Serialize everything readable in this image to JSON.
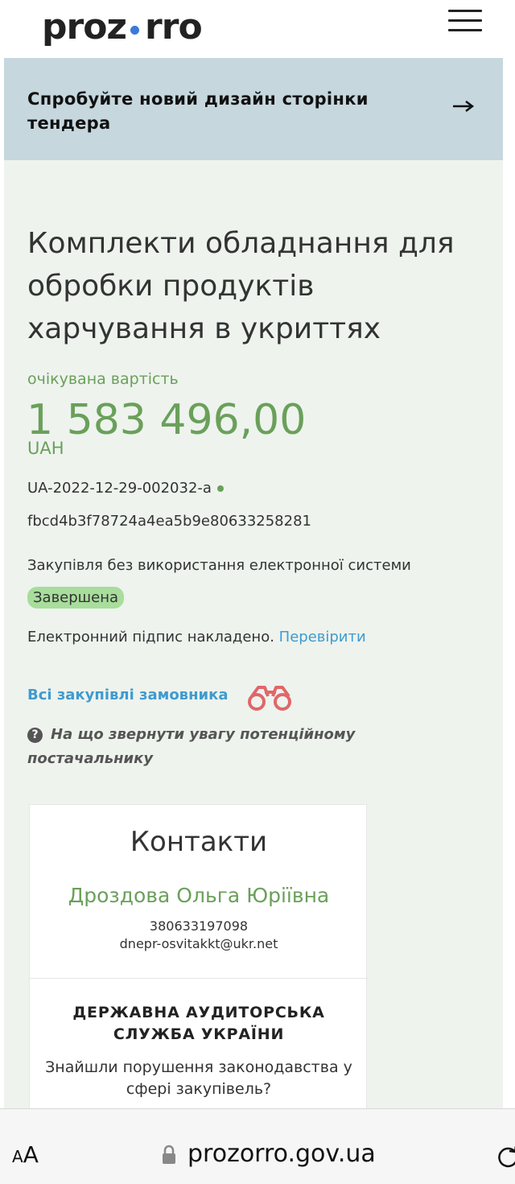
{
  "header": {
    "logo_left": "proz",
    "logo_right": "rro",
    "menu_icon": "hamburger-menu-icon"
  },
  "banner": {
    "text": "Спробуйте новий дизайн сторінки тендера",
    "icon": "arrow-right-icon"
  },
  "tender": {
    "title": "Комплекти обладнання для обробки продуктів харчування в укриттях",
    "estimated_label": "очікувана вартість",
    "amount": "1 583 496,00",
    "currency": "UAH",
    "id": "UA-2022-12-29-002032-a",
    "hash": "fbcd4b3f78724a4ea5b9e80633258281",
    "procurement_type": "Закупівля без використання електронної системи",
    "status": "Завершена",
    "signature_text": "Електронний підпис накладено. ",
    "signature_link": "Перевірити",
    "all_purchases_link": "Всі закупівлі замовника",
    "attention_text": "На що звернути увагу потенційному постачальнику"
  },
  "contacts": {
    "title": "Контакти",
    "name": "Дроздова Ольга Юріївна",
    "phone": "380633197098",
    "email": "dnepr-osvitakkt@ukr.net",
    "audit_title": "ДЕРЖАВНА АУДИТОРСЬКА СЛУЖБА УКРАЇНИ",
    "audit_question": "Знайшли порушення законодавства у сфері закупівель?"
  },
  "browser": {
    "aa_small": "A",
    "aa_large": "A",
    "url": "prozorro.gov.ua"
  },
  "colors": {
    "accent_green": "#6aa05a",
    "link_blue": "#3f9bcf",
    "banner_bg": "#c6d7de",
    "page_bg": "#eef3ee",
    "status_badge_bg": "#a8dd9c"
  }
}
